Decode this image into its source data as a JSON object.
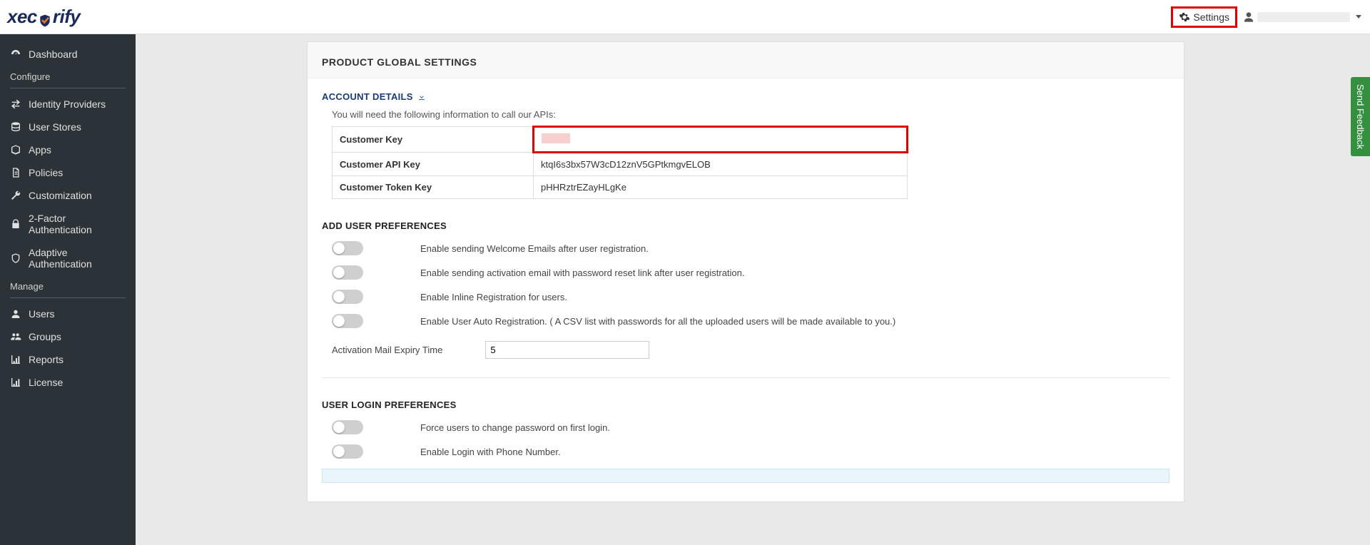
{
  "brand": {
    "name_left": "xec",
    "name_right": "rify"
  },
  "topbar": {
    "settings_label": "Settings"
  },
  "sidebar": {
    "dashboard_label": "Dashboard",
    "configure_header": "Configure",
    "configure": [
      {
        "label": "Identity Providers"
      },
      {
        "label": "User Stores"
      },
      {
        "label": "Apps"
      },
      {
        "label": "Policies"
      },
      {
        "label": "Customization"
      },
      {
        "label": "2-Factor Authentication"
      },
      {
        "label": "Adaptive Authentication"
      }
    ],
    "manage_header": "Manage",
    "manage": [
      {
        "label": "Users"
      },
      {
        "label": "Groups"
      },
      {
        "label": "Reports"
      },
      {
        "label": "License"
      }
    ]
  },
  "page": {
    "title": "PRODUCT GLOBAL SETTINGS",
    "account_details_title": "ACCOUNT DETAILS",
    "account_details_help": "You will need the following information to call our APIs:",
    "account_rows": [
      {
        "label": "Customer Key",
        "value": ""
      },
      {
        "label": "Customer API Key",
        "value": "ktqI6s3bx57W3cD12znV5GPtkmgvELOB"
      },
      {
        "label": "Customer Token Key",
        "value": "pHHRztrEZayHLgKe"
      }
    ],
    "add_user_prefs_title": "ADD USER PREFERENCES",
    "add_user_prefs": [
      {
        "desc": "Enable sending Welcome Emails after user registration."
      },
      {
        "desc": "Enable sending activation email with password reset link after user registration."
      },
      {
        "desc": "Enable Inline Registration for users."
      },
      {
        "desc": "Enable User Auto Registration. ( A CSV list with passwords for all the uploaded users will be made available to you.)"
      }
    ],
    "expiry_label": "Activation Mail Expiry Time",
    "expiry_value": "5",
    "login_prefs_title": "USER LOGIN PREFERENCES",
    "login_prefs": [
      {
        "desc": "Force users to change password on first login."
      },
      {
        "desc": "Enable Login with Phone Number."
      }
    ]
  },
  "feedback_label": "Send Feedback"
}
